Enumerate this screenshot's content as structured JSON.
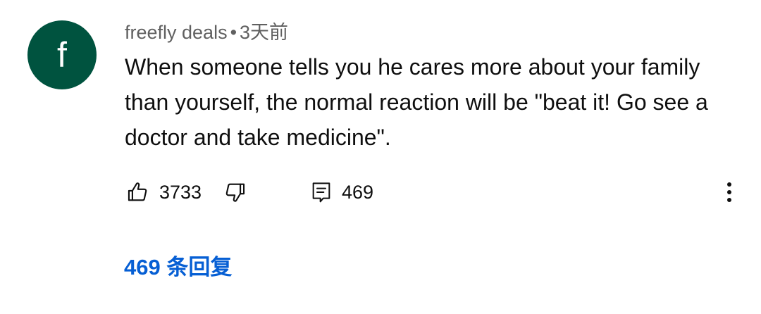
{
  "comment": {
    "avatar_letter": "f",
    "avatar_color": "#00533f",
    "author": "freefly deals",
    "separator": "•",
    "time": "3天前",
    "text": "When someone tells you he cares more about your family than yourself, the normal reaction will be \"beat it! Go see a doctor and take medicine\"."
  },
  "actions": {
    "like_icon": "thumb-up-icon",
    "like_count": "3733",
    "dislike_icon": "thumb-down-icon",
    "reply_icon": "comment-icon",
    "reply_count": "469",
    "more_icon": "more-vertical-icon"
  },
  "replies": {
    "label": "469 条回复",
    "color": "#065fd4"
  }
}
